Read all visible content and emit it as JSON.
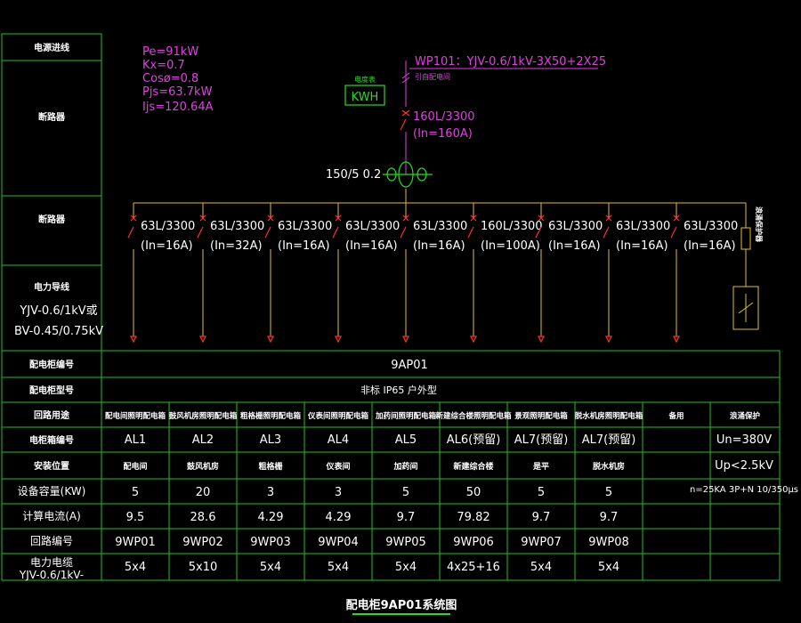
{
  "left_labels": {
    "incoming": "电源进线",
    "main_breaker": "断路器",
    "branch_breaker": "断路器",
    "cable_title": "电力导线",
    "cable_1": "YJV-0.6/1kV或",
    "cable_2": "BV-0.45/0.75kV"
  },
  "load_params": [
    "Pe=91kW",
    "Kx=0.7",
    "Cosø=0.8",
    "Pjs=63.7kW",
    "Ijs=120.64A"
  ],
  "incoming": {
    "cable": "WP101：YJV-0.6/1kV-3X50+2X25",
    "note": "引自配电间",
    "meter_label": "电度表",
    "meter": "KWH",
    "breaker": "160L/3300",
    "breaker_in": "(In=160A)",
    "ct": "150/5 0.2"
  },
  "branches": [
    {
      "breaker": "63L/3300",
      "in": "(In=16A)"
    },
    {
      "breaker": "63L/3300",
      "in": "(In=32A)"
    },
    {
      "breaker": "63L/3300",
      "in": "(In=16A)"
    },
    {
      "breaker": "63L/3300",
      "in": "(In=16A)"
    },
    {
      "breaker": "63L/3300",
      "in": "(In=16A)"
    },
    {
      "breaker": "160L/3300",
      "in": "(In=100A)"
    },
    {
      "breaker": "63L/3300",
      "in": "(In=16A)"
    },
    {
      "breaker": "63L/3300",
      "in": "(In=16A)"
    },
    {
      "breaker": "63L/3300",
      "in": "(In=16A)"
    }
  ],
  "surge_label": "浪涌保护器",
  "table": {
    "row_labels": [
      "配电柜编号",
      "配电柜型号",
      "回路用途",
      "电柜箱编号",
      "安装位置",
      "设备容量(KW)",
      "计算电流(A)",
      "回路编号",
      "电力电缆",
      "YJV-0.6/1kV-"
    ],
    "cabinet_no": "9AP01",
    "cabinet_type": "非标  IP65 户外型",
    "purposes": [
      "配电间照明配电箱",
      "鼓风机房照明配电箱",
      "粗格栅照明配电箱",
      "仪表间照明配电箱",
      "加药间照明配电箱",
      "新建综合楼照明配电箱",
      "景观照明配电箱",
      "脱水机房照明配电箱",
      "备用",
      "浪涌保护"
    ],
    "box_no": [
      "AL1",
      "AL2",
      "AL3",
      "AL4",
      "AL5",
      "AL6(预留)",
      "AL7(预留)",
      "AL7(预留)"
    ],
    "location": [
      "配电间",
      "鼓风机房",
      "粗格栅",
      "仪表间",
      "加药间",
      "新建综合楼",
      "是平",
      "脱水机房"
    ],
    "capacity": [
      "5",
      "20",
      "3",
      "3",
      "5",
      "50",
      "5",
      "5"
    ],
    "current": [
      "9.5",
      "28.6",
      "4.29",
      "4.29",
      "9.7",
      "79.82",
      "9.7",
      "9.7"
    ],
    "circuit_no": [
      "9WP01",
      "9WP02",
      "9WP03",
      "9WP04",
      "9WP05",
      "9WP06",
      "9WP07",
      "9WP08"
    ],
    "cable": [
      "5x4",
      "5x10",
      "5x4",
      "5x4",
      "5x4",
      "4x25+16",
      "5x4",
      "5x4"
    ],
    "surge_values": [
      "Un=380V",
      "Up<2.5kV",
      "n=25KA 3P+N 10/350µs"
    ]
  },
  "title": "配电柜9AP01系统图",
  "colors": {
    "frame": "#20c020",
    "bus": "#e0c020",
    "breaker": "#ff3030",
    "annotation": "#e040e0"
  }
}
